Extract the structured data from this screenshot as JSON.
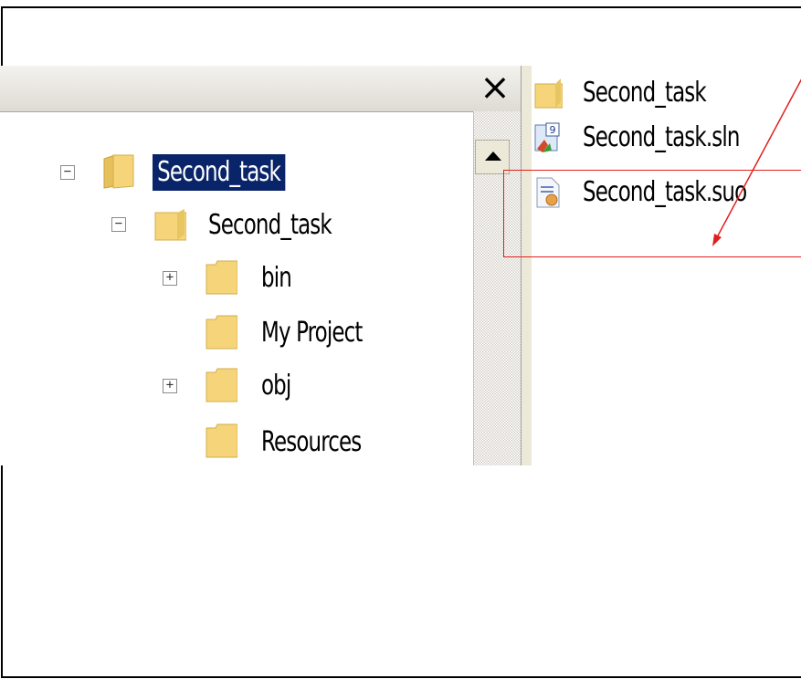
{
  "tree": {
    "close_glyph": "×",
    "nodes": [
      {
        "label": "Second_task",
        "toggle": "−",
        "selected": true
      },
      {
        "label": "Second_task",
        "toggle": "−",
        "selected": false
      },
      {
        "label": "bin",
        "toggle": "+",
        "selected": false
      },
      {
        "label": "My Project",
        "toggle": "",
        "selected": false
      },
      {
        "label": "obj",
        "toggle": "+",
        "selected": false
      },
      {
        "label": "Resources",
        "toggle": "",
        "selected": false
      }
    ]
  },
  "files": [
    {
      "name": "Second_task",
      "icon": "folder-icon"
    },
    {
      "name": "Second_task.sln",
      "icon": "solution-file-icon"
    },
    {
      "name": "Second_task.suo",
      "icon": "suo-file-icon"
    }
  ],
  "colors": {
    "selection": "#0a246a",
    "annotation": "#e0201e",
    "folder": "#f6d47a"
  }
}
